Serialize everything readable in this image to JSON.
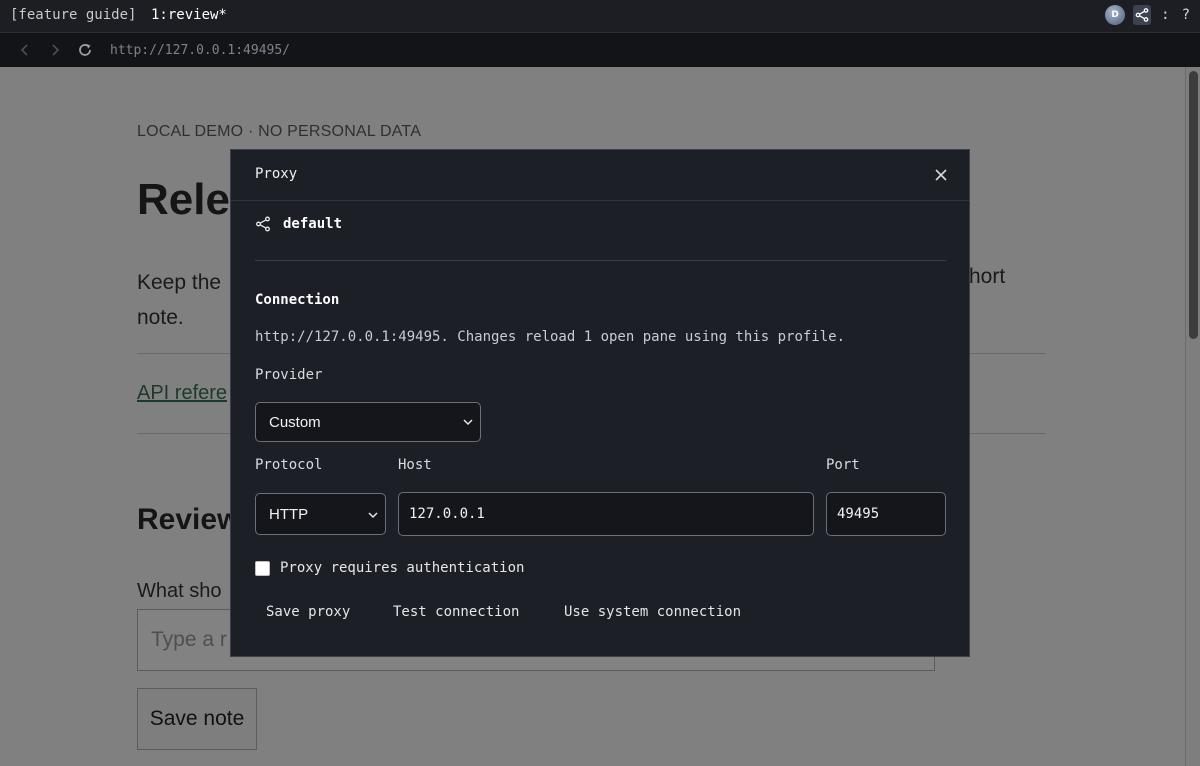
{
  "tabbar": {
    "session": "[feature guide]",
    "window": "1:review*",
    "avatar_initial": "D",
    "menu_label": ":",
    "help_label": "?"
  },
  "navbar": {
    "url": "http://127.0.0.1:49495/"
  },
  "page": {
    "eyebrow": "LOCAL DEMO · NO PERSONAL DATA",
    "heading": "Rele",
    "lead": "Keep the",
    "lead_right": "hort",
    "lead_line2": "note.",
    "link": "API refere",
    "section_heading": "Review",
    "field_label": "What sho",
    "input_placeholder": "Type a r",
    "save_button": "Save note"
  },
  "modal": {
    "title": "Proxy",
    "profile_name": "default",
    "section_title": "Connection",
    "description": "http://127.0.0.1:49495. Changes reload 1 open pane using this profile.",
    "provider_label": "Provider",
    "provider_value": "Custom",
    "protocol_label": "Protocol",
    "protocol_value": "HTTP",
    "host_label": "Host",
    "host_value": "127.0.0.1",
    "port_label": "Port",
    "port_value": "49495",
    "auth_label": "Proxy requires authentication",
    "auth_checked": false,
    "actions": {
      "save": "Save proxy",
      "test": "Test connection",
      "system": "Use system connection"
    }
  },
  "colors": {
    "modal_bg": "#1c1f26",
    "overlay": "#808080",
    "input_bg": "#14161b"
  }
}
